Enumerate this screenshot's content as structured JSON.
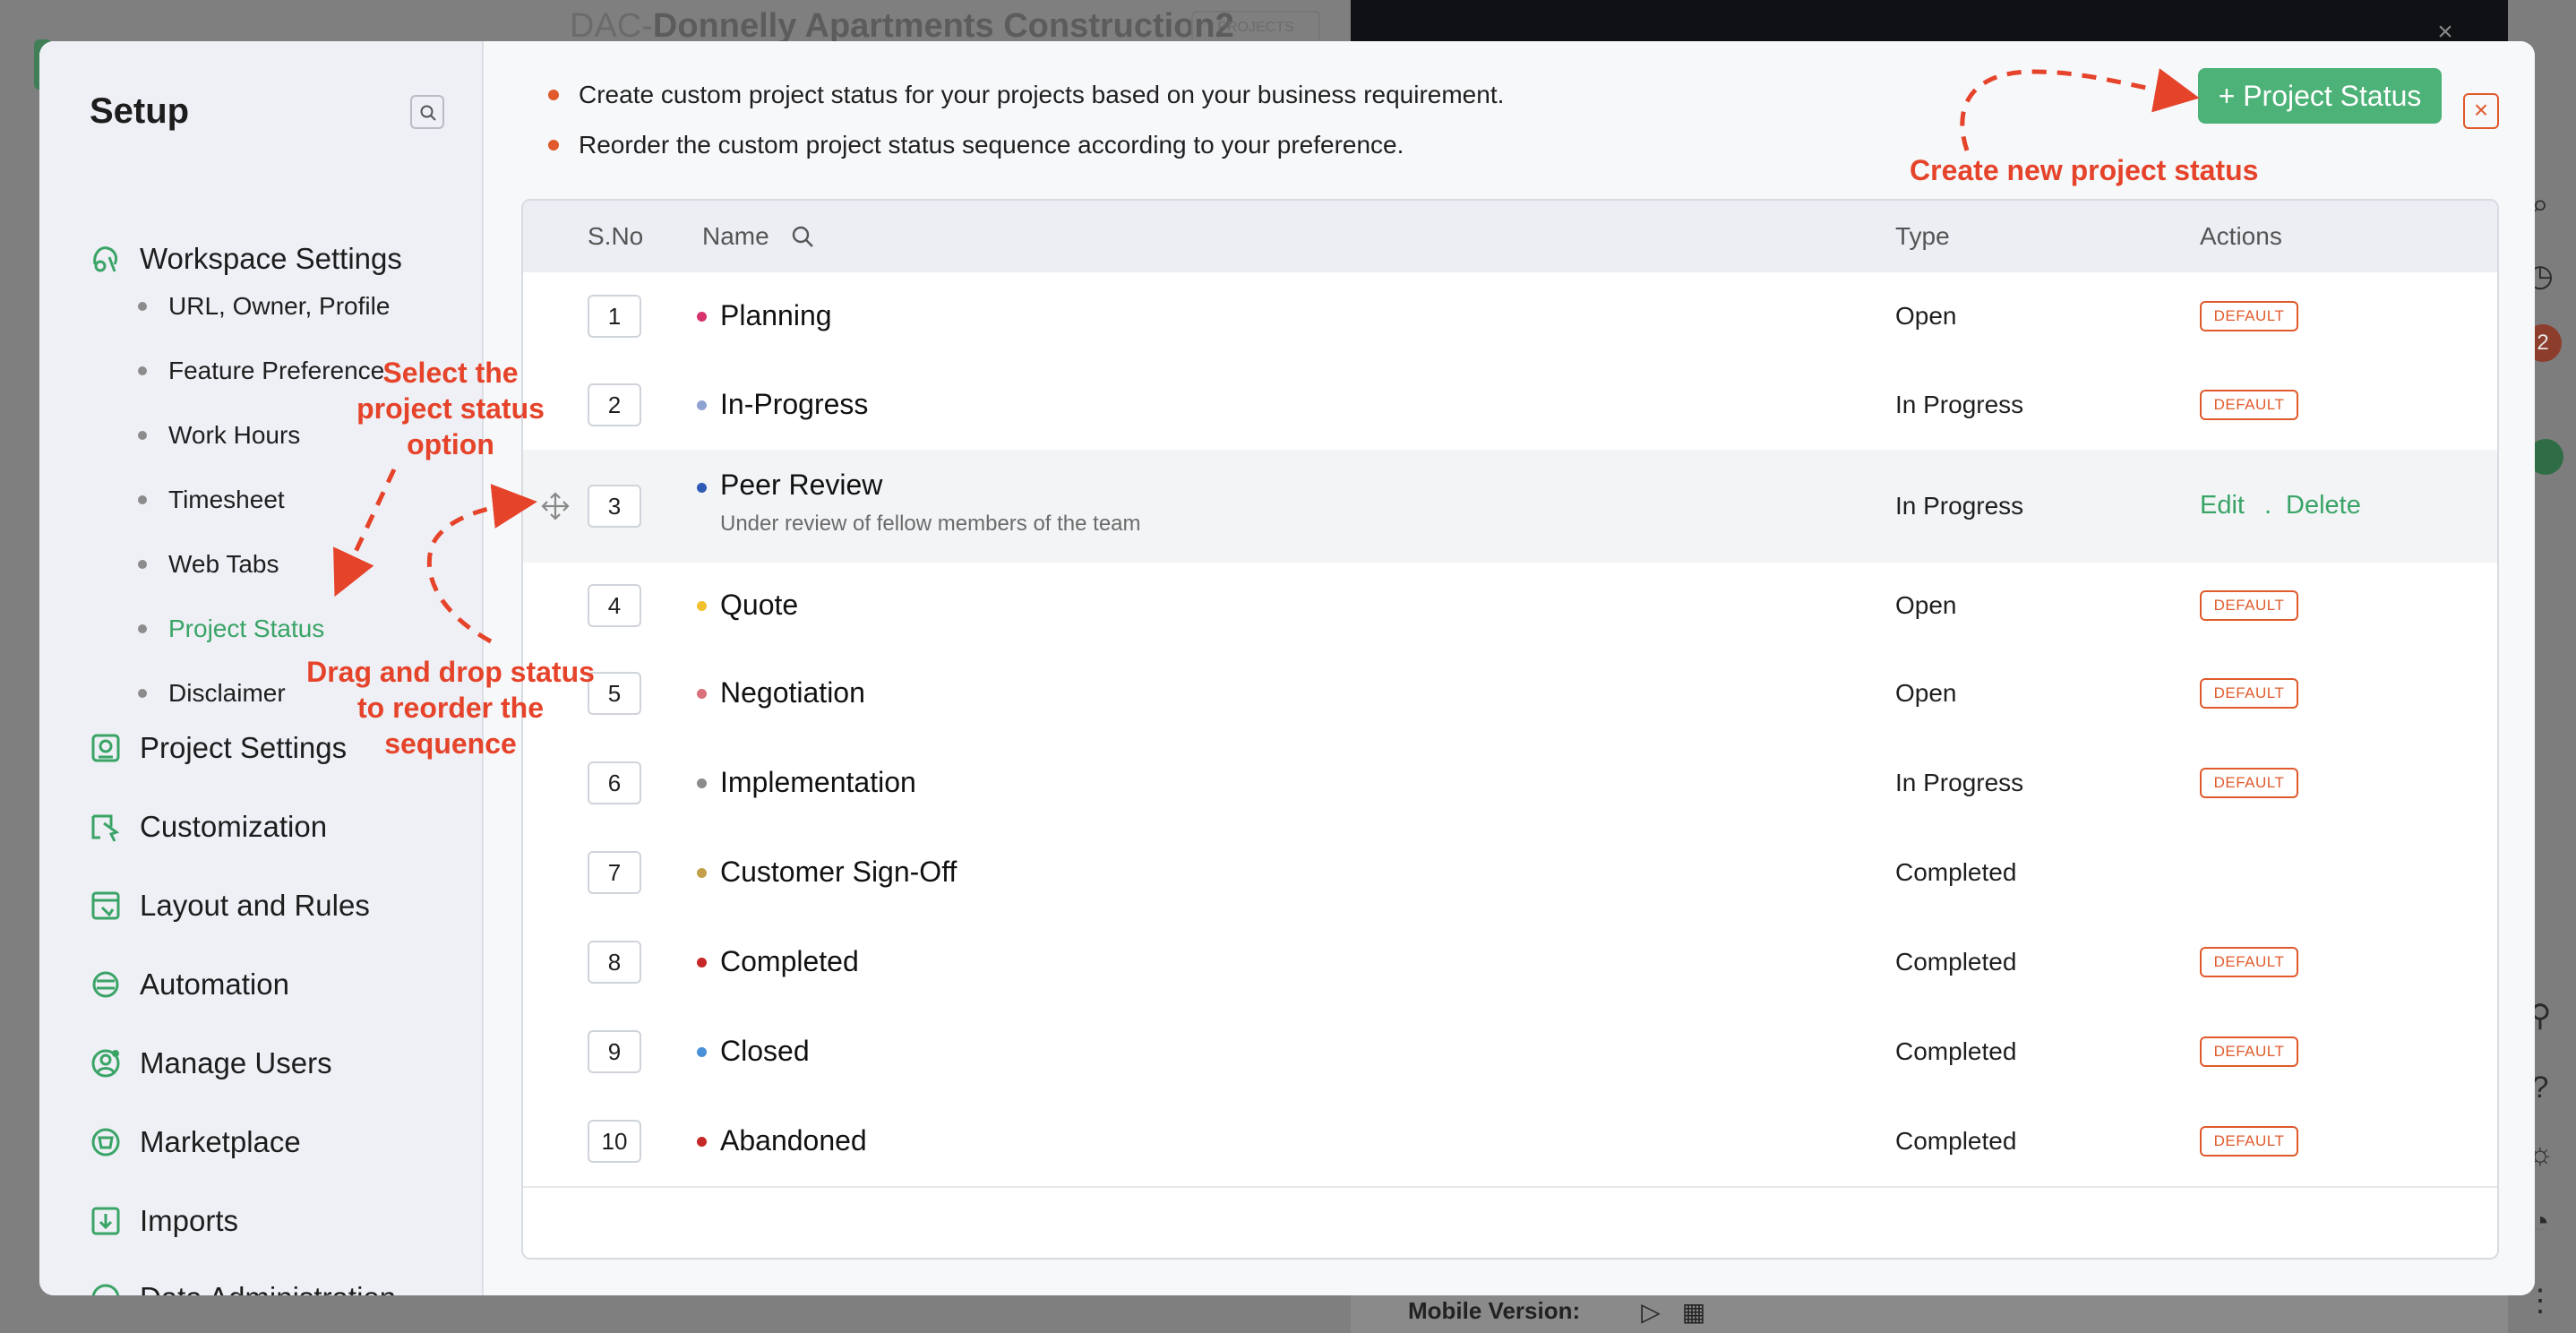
{
  "background": {
    "title_prefix": "DAC-",
    "title": "Donnelly Apartments Construction2",
    "chip": "PROJECTS",
    "rail_badge": "2",
    "mobile_version_label": "Mobile Version:",
    "colors": {
      "dim": "#7f7f7f",
      "dark_panel": "#0f1115"
    }
  },
  "sidebar": {
    "title": "Setup",
    "groups": [
      {
        "label": "Workspace Settings",
        "icon": "workspace-icon"
      },
      {
        "label": "Project Settings",
        "icon": "project-settings-icon"
      },
      {
        "label": "Customization",
        "icon": "customization-icon"
      },
      {
        "label": "Layout and Rules",
        "icon": "layout-rules-icon"
      },
      {
        "label": "Automation",
        "icon": "automation-icon"
      },
      {
        "label": "Manage Users",
        "icon": "manage-users-icon"
      },
      {
        "label": "Marketplace",
        "icon": "marketplace-icon"
      },
      {
        "label": "Imports",
        "icon": "imports-icon"
      },
      {
        "label": "Data Administration",
        "icon": "data-admin-icon"
      }
    ],
    "workspace_items": [
      {
        "label": "URL, Owner, Profile"
      },
      {
        "label": "Feature Preference"
      },
      {
        "label": "Work Hours"
      },
      {
        "label": "Timesheet"
      },
      {
        "label": "Web Tabs"
      },
      {
        "label": "Project Status",
        "active": true
      },
      {
        "label": "Disclaimer"
      }
    ]
  },
  "main": {
    "bullets": [
      "Create custom project status for your projects based on your business requirement.",
      "Reorder the custom project status sequence according to your preference."
    ],
    "add_button": "+ Project Status",
    "table": {
      "headers": {
        "sno": "S.No",
        "name": "Name",
        "type": "Type",
        "actions": "Actions"
      },
      "default_badge": "DEFAULT",
      "edit_label": "Edit",
      "separator": ".",
      "delete_label": "Delete",
      "rows": [
        {
          "sno": "1",
          "name": "Planning",
          "type": "Open",
          "color": "#d6336c",
          "default": true
        },
        {
          "sno": "2",
          "name": "In-Progress",
          "type": "In Progress",
          "color": "#8fa3d1",
          "default": true
        },
        {
          "sno": "3",
          "name": "Peer Review",
          "description": "Under review of fellow members of the team",
          "type": "In Progress",
          "color": "#2f5bb7",
          "default": false,
          "editable": true
        },
        {
          "sno": "4",
          "name": "Quote",
          "type": "Open",
          "color": "#f2c12e",
          "default": true
        },
        {
          "sno": "5",
          "name": "Negotiation",
          "type": "Open",
          "color": "#d9707a",
          "default": true
        },
        {
          "sno": "6",
          "name": "Implementation",
          "type": "In Progress",
          "color": "#8c8c8c",
          "default": true
        },
        {
          "sno": "7",
          "name": "Customer Sign-Off",
          "type": "Completed",
          "color": "#c2a04a",
          "default": false
        },
        {
          "sno": "8",
          "name": "Completed",
          "type": "Completed",
          "color": "#c62828",
          "default": true
        },
        {
          "sno": "9",
          "name": "Closed",
          "type": "Completed",
          "color": "#4a90d9",
          "default": true
        },
        {
          "sno": "10",
          "name": "Abandoned",
          "type": "Completed",
          "color": "#c62828",
          "default": true
        }
      ]
    }
  },
  "annotations": {
    "create": "Create new project status",
    "select": [
      "Select the",
      "project status",
      "option"
    ],
    "drag": [
      "Drag and drop status",
      "to reorder the",
      "sequence"
    ],
    "color": "#e5432a"
  },
  "accent": {
    "green": "#4db277",
    "orange": "#e05a2c"
  }
}
